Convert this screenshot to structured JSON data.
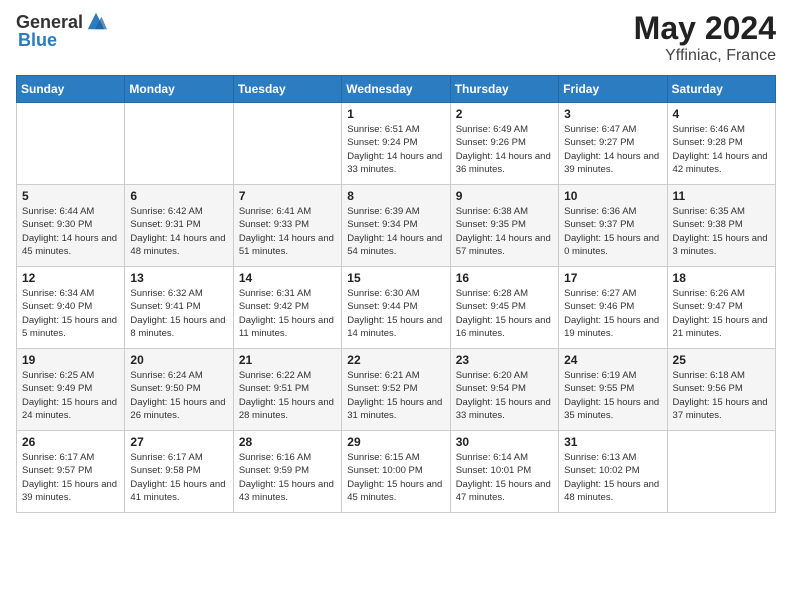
{
  "header": {
    "logo_general": "General",
    "logo_blue": "Blue",
    "month": "May 2024",
    "location": "Yffiniac, France"
  },
  "weekdays": [
    "Sunday",
    "Monday",
    "Tuesday",
    "Wednesday",
    "Thursday",
    "Friday",
    "Saturday"
  ],
  "weeks": [
    [
      {
        "date": "",
        "info": ""
      },
      {
        "date": "",
        "info": ""
      },
      {
        "date": "",
        "info": ""
      },
      {
        "date": "1",
        "info": "Sunrise: 6:51 AM\nSunset: 9:24 PM\nDaylight: 14 hours and 33 minutes."
      },
      {
        "date": "2",
        "info": "Sunrise: 6:49 AM\nSunset: 9:26 PM\nDaylight: 14 hours and 36 minutes."
      },
      {
        "date": "3",
        "info": "Sunrise: 6:47 AM\nSunset: 9:27 PM\nDaylight: 14 hours and 39 minutes."
      },
      {
        "date": "4",
        "info": "Sunrise: 6:46 AM\nSunset: 9:28 PM\nDaylight: 14 hours and 42 minutes."
      }
    ],
    [
      {
        "date": "5",
        "info": "Sunrise: 6:44 AM\nSunset: 9:30 PM\nDaylight: 14 hours and 45 minutes."
      },
      {
        "date": "6",
        "info": "Sunrise: 6:42 AM\nSunset: 9:31 PM\nDaylight: 14 hours and 48 minutes."
      },
      {
        "date": "7",
        "info": "Sunrise: 6:41 AM\nSunset: 9:33 PM\nDaylight: 14 hours and 51 minutes."
      },
      {
        "date": "8",
        "info": "Sunrise: 6:39 AM\nSunset: 9:34 PM\nDaylight: 14 hours and 54 minutes."
      },
      {
        "date": "9",
        "info": "Sunrise: 6:38 AM\nSunset: 9:35 PM\nDaylight: 14 hours and 57 minutes."
      },
      {
        "date": "10",
        "info": "Sunrise: 6:36 AM\nSunset: 9:37 PM\nDaylight: 15 hours and 0 minutes."
      },
      {
        "date": "11",
        "info": "Sunrise: 6:35 AM\nSunset: 9:38 PM\nDaylight: 15 hours and 3 minutes."
      }
    ],
    [
      {
        "date": "12",
        "info": "Sunrise: 6:34 AM\nSunset: 9:40 PM\nDaylight: 15 hours and 5 minutes."
      },
      {
        "date": "13",
        "info": "Sunrise: 6:32 AM\nSunset: 9:41 PM\nDaylight: 15 hours and 8 minutes."
      },
      {
        "date": "14",
        "info": "Sunrise: 6:31 AM\nSunset: 9:42 PM\nDaylight: 15 hours and 11 minutes."
      },
      {
        "date": "15",
        "info": "Sunrise: 6:30 AM\nSunset: 9:44 PM\nDaylight: 15 hours and 14 minutes."
      },
      {
        "date": "16",
        "info": "Sunrise: 6:28 AM\nSunset: 9:45 PM\nDaylight: 15 hours and 16 minutes."
      },
      {
        "date": "17",
        "info": "Sunrise: 6:27 AM\nSunset: 9:46 PM\nDaylight: 15 hours and 19 minutes."
      },
      {
        "date": "18",
        "info": "Sunrise: 6:26 AM\nSunset: 9:47 PM\nDaylight: 15 hours and 21 minutes."
      }
    ],
    [
      {
        "date": "19",
        "info": "Sunrise: 6:25 AM\nSunset: 9:49 PM\nDaylight: 15 hours and 24 minutes."
      },
      {
        "date": "20",
        "info": "Sunrise: 6:24 AM\nSunset: 9:50 PM\nDaylight: 15 hours and 26 minutes."
      },
      {
        "date": "21",
        "info": "Sunrise: 6:22 AM\nSunset: 9:51 PM\nDaylight: 15 hours and 28 minutes."
      },
      {
        "date": "22",
        "info": "Sunrise: 6:21 AM\nSunset: 9:52 PM\nDaylight: 15 hours and 31 minutes."
      },
      {
        "date": "23",
        "info": "Sunrise: 6:20 AM\nSunset: 9:54 PM\nDaylight: 15 hours and 33 minutes."
      },
      {
        "date": "24",
        "info": "Sunrise: 6:19 AM\nSunset: 9:55 PM\nDaylight: 15 hours and 35 minutes."
      },
      {
        "date": "25",
        "info": "Sunrise: 6:18 AM\nSunset: 9:56 PM\nDaylight: 15 hours and 37 minutes."
      }
    ],
    [
      {
        "date": "26",
        "info": "Sunrise: 6:17 AM\nSunset: 9:57 PM\nDaylight: 15 hours and 39 minutes."
      },
      {
        "date": "27",
        "info": "Sunrise: 6:17 AM\nSunset: 9:58 PM\nDaylight: 15 hours and 41 minutes."
      },
      {
        "date": "28",
        "info": "Sunrise: 6:16 AM\nSunset: 9:59 PM\nDaylight: 15 hours and 43 minutes."
      },
      {
        "date": "29",
        "info": "Sunrise: 6:15 AM\nSunset: 10:00 PM\nDaylight: 15 hours and 45 minutes."
      },
      {
        "date": "30",
        "info": "Sunrise: 6:14 AM\nSunset: 10:01 PM\nDaylight: 15 hours and 47 minutes."
      },
      {
        "date": "31",
        "info": "Sunrise: 6:13 AM\nSunset: 10:02 PM\nDaylight: 15 hours and 48 minutes."
      },
      {
        "date": "",
        "info": ""
      }
    ]
  ]
}
